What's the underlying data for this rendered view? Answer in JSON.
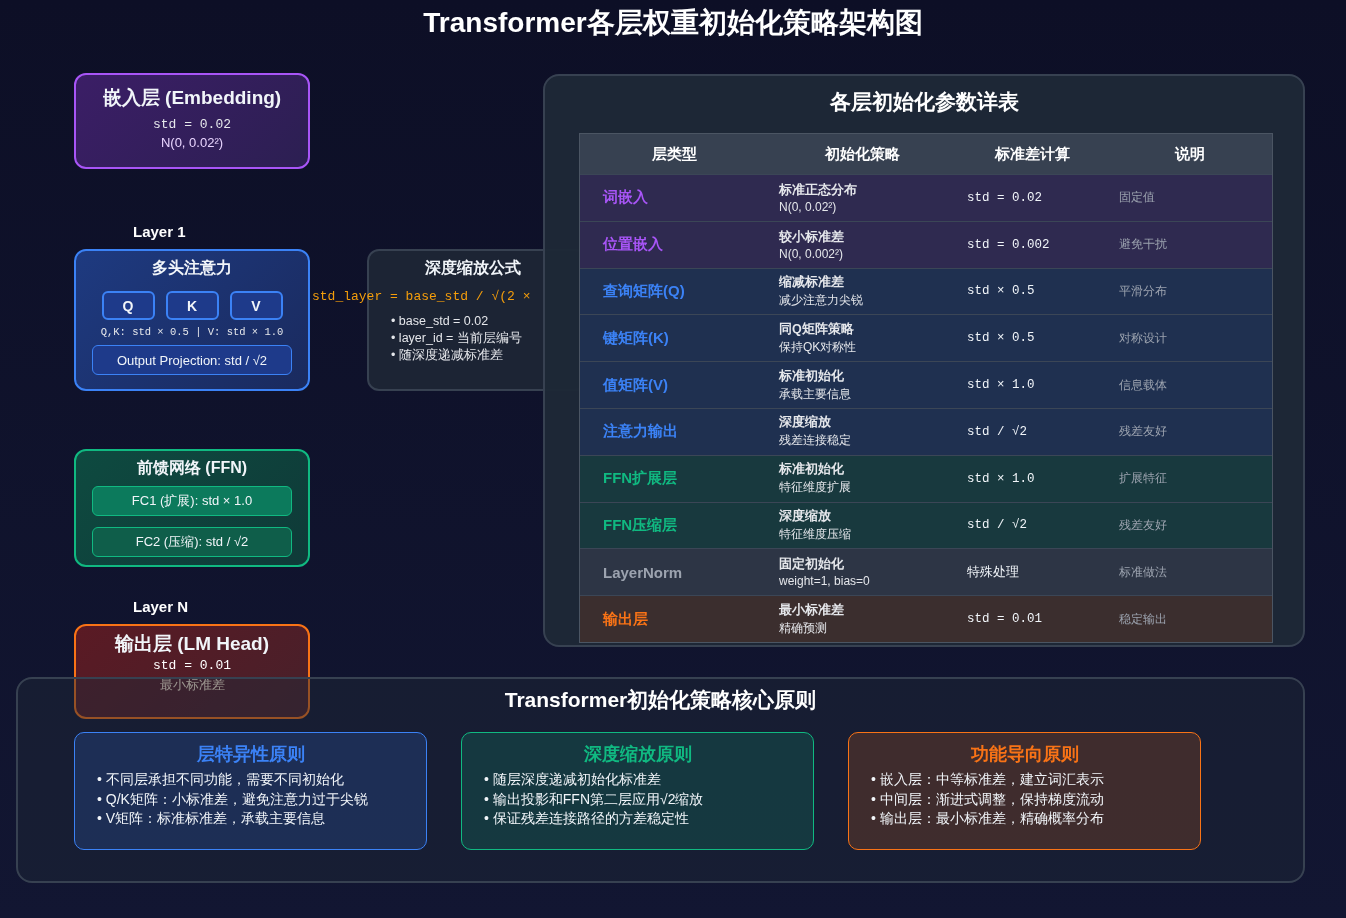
{
  "title": "Transformer各层权重初始化策略架构图",
  "embedding": {
    "title": "嵌入层 (Embedding)",
    "std": "std = 0.02",
    "distribution": "N(0, 0.02²)"
  },
  "layer_1": {
    "label": "Layer 1",
    "attention": {
      "title": "多头注意力",
      "heads": [
        "Q",
        "K",
        "V"
      ],
      "scaling": "Q,K: std × 0.5 | V: std × 1.0",
      "output_projection": "Output Projection: std / √2"
    }
  },
  "formula": {
    "title": "深度缩放公式",
    "expression": "std_layer = base_std / √(2 ×",
    "bullets": [
      "• base_std = 0.02",
      "• layer_id = 当前层编号",
      "• 随深度递减标准差"
    ]
  },
  "ffn": {
    "title": "前馈网络 (FFN)",
    "layers": [
      "FC1 (扩展): std × 1.0",
      "FC2 (压缩): std / √2"
    ]
  },
  "layer_n": {
    "label": "Layer N",
    "output": {
      "title": "输出层 (LM Head)",
      "std": "std = 0.01",
      "note": "最小标准差"
    }
  },
  "table_panel": {
    "title": "各层初始化参数详表",
    "columns": [
      "层类型",
      "初始化策略",
      "标准差计算",
      "说明"
    ],
    "rows": [
      {
        "layer": "词嵌入",
        "color": "#a855f7",
        "strategy": "标准正态分布",
        "detail": "N(0, 0.02²)",
        "std": "std = 0.02",
        "note": "固定值"
      },
      {
        "layer": "位置嵌入",
        "color": "#a855f7",
        "strategy": "较小标准差",
        "detail": "N(0, 0.002²)",
        "std": "std = 0.002",
        "note": "避免干扰"
      },
      {
        "layer": "查询矩阵(Q)",
        "color": "#3b82f6",
        "strategy": "缩减标准差",
        "detail": "减少注意力尖锐",
        "std": "std × 0.5",
        "note": "平滑分布"
      },
      {
        "layer": "键矩阵(K)",
        "color": "#3b82f6",
        "strategy": "同Q矩阵策略",
        "detail": "保持QK对称性",
        "std": "std × 0.5",
        "note": "对称设计"
      },
      {
        "layer": "值矩阵(V)",
        "color": "#3b82f6",
        "strategy": "标准初始化",
        "detail": "承载主要信息",
        "std": "std × 1.0",
        "note": "信息载体"
      },
      {
        "layer": "注意力输出",
        "color": "#3b82f6",
        "strategy": "深度缩放",
        "detail": "残差连接稳定",
        "std": "std / √2",
        "note": "残差友好"
      },
      {
        "layer": "FFN扩展层",
        "color": "#10b981",
        "strategy": "标准初始化",
        "detail": "特征维度扩展",
        "std": "std × 1.0",
        "note": "扩展特征"
      },
      {
        "layer": "FFN压缩层",
        "color": "#10b981",
        "strategy": "深度缩放",
        "detail": "特征维度压缩",
        "std": "std / √2",
        "note": "残差友好"
      },
      {
        "layer": "LayerNorm",
        "color": "#9ca3af",
        "strategy": "固定初始化",
        "detail": "weight=1, bias=0",
        "std": "特殊处理",
        "note": "标准做法"
      },
      {
        "layer": "输出层",
        "color": "#f97316",
        "strategy": "最小标准差",
        "detail": "精确预测",
        "std": "std = 0.01",
        "note": "稳定输出"
      }
    ]
  },
  "principles": {
    "title": "Transformer初始化策略核心原则",
    "cards": [
      {
        "title": "层特异性原则",
        "color": "#3b82f6",
        "points": [
          "• 不同层承担不同功能，需要不同初始化",
          "• Q/K矩阵：小标准差，避免注意力过于尖锐",
          "• V矩阵：标准标准差，承载主要信息"
        ]
      },
      {
        "title": "深度缩放原则",
        "color": "#10b981",
        "points": [
          "• 随层深度递减初始化标准差",
          "• 输出投影和FFN第二层应用√2缩放",
          "• 保证残差连接路径的方差稳定性"
        ]
      },
      {
        "title": "功能导向原则",
        "color": "#f97316",
        "points": [
          "• 嵌入层：中等标准差，建立词汇表示",
          "• 中间层：渐进式调整，保持梯度流动",
          "• 输出层：最小标准差，精确概率分布"
        ]
      }
    ]
  }
}
